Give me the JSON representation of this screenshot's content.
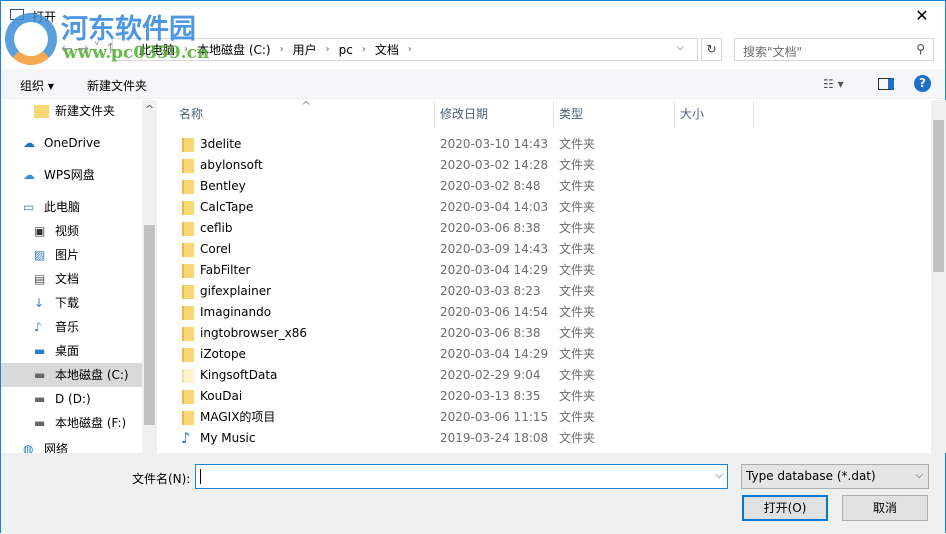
{
  "title": "打开",
  "watermark": {
    "name": "河东软件园",
    "url": "www.pc0359.cn"
  },
  "address": {
    "crumbs": [
      "此电脑",
      "本地磁盘 (C:)",
      "用户",
      "pc",
      "文档"
    ]
  },
  "search": {
    "placeholder": "搜索\"文档\""
  },
  "toolbar": {
    "organize": "组织 ▾",
    "new_folder": "新建文件夹"
  },
  "nav": [
    {
      "label": "新建文件夹",
      "icon": "folder-icon"
    },
    {
      "label": "OneDrive",
      "icon": "cloud-icon"
    },
    {
      "label": "WPS网盘",
      "icon": "cloud-outline-icon"
    },
    {
      "label": "此电脑",
      "icon": "computer-icon"
    },
    {
      "label": "视频",
      "icon": "video-icon"
    },
    {
      "label": "图片",
      "icon": "picture-icon"
    },
    {
      "label": "文档",
      "icon": "document-icon"
    },
    {
      "label": "下载",
      "icon": "download-icon"
    },
    {
      "label": "音乐",
      "icon": "music-icon"
    },
    {
      "label": "桌面",
      "icon": "desktop-icon"
    },
    {
      "label": "本地磁盘 (C:)",
      "icon": "drive-icon",
      "selected": true
    },
    {
      "label": "D (D:)",
      "icon": "drive-icon"
    },
    {
      "label": "本地磁盘 (F:)",
      "icon": "drive-icon"
    },
    {
      "label": "网络",
      "icon": "network-icon"
    }
  ],
  "columns": {
    "name": "名称",
    "date": "修改日期",
    "type": "类型",
    "size": "大小"
  },
  "files": [
    {
      "name": "3delite",
      "date": "2020-03-10 14:43",
      "type": "文件夹"
    },
    {
      "name": "abylonsoft",
      "date": "2020-03-02 14:28",
      "type": "文件夹"
    },
    {
      "name": "Bentley",
      "date": "2020-03-02 8:48",
      "type": "文件夹"
    },
    {
      "name": "CalcTape",
      "date": "2020-03-04 14:03",
      "type": "文件夹"
    },
    {
      "name": "ceflib",
      "date": "2020-03-06 8:38",
      "type": "文件夹"
    },
    {
      "name": "Corel",
      "date": "2020-03-09 14:43",
      "type": "文件夹"
    },
    {
      "name": "FabFilter",
      "date": "2020-03-04 14:29",
      "type": "文件夹"
    },
    {
      "name": "gifexplainer",
      "date": "2020-03-03 8:23",
      "type": "文件夹"
    },
    {
      "name": "Imaginando",
      "date": "2020-03-06 14:54",
      "type": "文件夹"
    },
    {
      "name": "ingtobrowser_x86",
      "date": "2020-03-06 8:38",
      "type": "文件夹"
    },
    {
      "name": "iZotope",
      "date": "2020-03-04 14:29",
      "type": "文件夹"
    },
    {
      "name": "KingsoftData",
      "date": "2020-02-29 9:04",
      "type": "文件夹"
    },
    {
      "name": "KouDai",
      "date": "2020-03-13 8:35",
      "type": "文件夹"
    },
    {
      "name": "MAGIX的项目",
      "date": "2020-03-06 11:15",
      "type": "文件夹"
    },
    {
      "name": "My Music",
      "date": "2019-03-24 18:08",
      "type": "文件夹"
    }
  ],
  "bottom": {
    "filename_label": "文件名(N):",
    "filename_value": "",
    "filter": "Type database (*.dat)",
    "open": "打开(O)",
    "cancel": "取消"
  }
}
